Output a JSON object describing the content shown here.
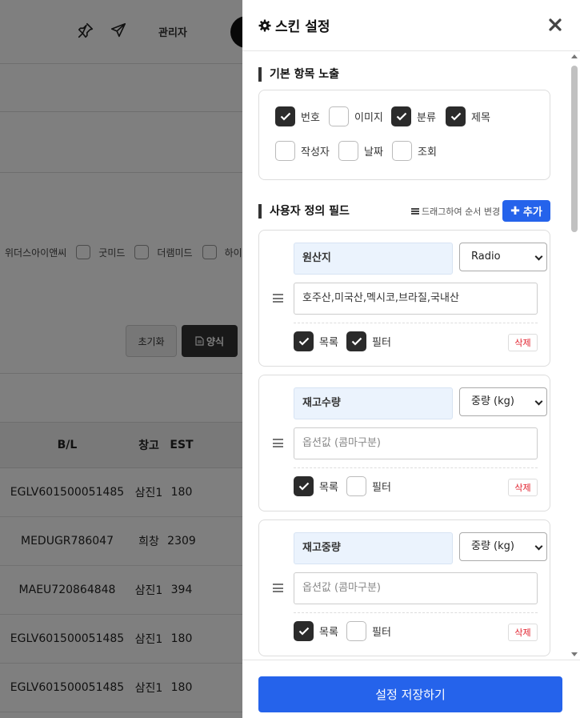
{
  "background": {
    "admin_label": "관리자",
    "filter_items": [
      "위더스아이앤씨",
      "굿미드",
      "더램미드",
      "하이"
    ],
    "reset_button": "초기화",
    "form_button": "양식",
    "table": {
      "headers": [
        "B/L",
        "창고",
        "EST"
      ],
      "rows": [
        [
          "EGLV601500051485",
          "삼진1",
          "180"
        ],
        [
          "MEDUGR786047",
          "희창",
          "2309"
        ],
        [
          "MAEU720864848",
          "삼진1",
          "394"
        ],
        [
          "EGLV601500051485",
          "삼진1",
          "180"
        ],
        [
          "EGLV601500051485",
          "삼진1",
          "180"
        ]
      ]
    }
  },
  "panel": {
    "title": "스킨 설정",
    "basic_section": {
      "title": "기본 항목 노출",
      "items": [
        {
          "label": "번호",
          "checked": true
        },
        {
          "label": "이미지",
          "checked": false
        },
        {
          "label": "분류",
          "checked": true
        },
        {
          "label": "제목",
          "checked": true
        },
        {
          "label": "작성자",
          "checked": false
        },
        {
          "label": "날짜",
          "checked": false
        },
        {
          "label": "조회",
          "checked": false
        }
      ]
    },
    "custom_section": {
      "title": "사용자 정의 필드",
      "drag_hint": "드래그하여 순서 변경",
      "add_button": "추가",
      "fields": [
        {
          "name": "원산지",
          "type": "Radio",
          "options_value": "호주산,미국산,멕시코,브라질,국내산",
          "options_placeholder": "",
          "list_label": "목록",
          "list_checked": true,
          "filter_label": "필터",
          "filter_checked": true,
          "delete_label": "삭제"
        },
        {
          "name": "재고수량",
          "type": "중량 (kg)",
          "options_value": "",
          "options_placeholder": "옵션값 (콤마구분)",
          "list_label": "목록",
          "list_checked": true,
          "filter_label": "필터",
          "filter_checked": false,
          "delete_label": "삭제"
        },
        {
          "name": "재고중량",
          "type": "중량 (kg)",
          "options_value": "",
          "options_placeholder": "옵션값 (콤마구분)",
          "list_label": "목록",
          "list_checked": true,
          "filter_label": "필터",
          "filter_checked": false,
          "delete_label": "삭제"
        }
      ]
    },
    "save_button": "설정 저장하기"
  },
  "colors": {
    "primary": "#2563eb",
    "checkbox_on": "#2b2b2b",
    "name_box_bg": "#ebf3fd",
    "delete_text": "#e11d2a"
  }
}
